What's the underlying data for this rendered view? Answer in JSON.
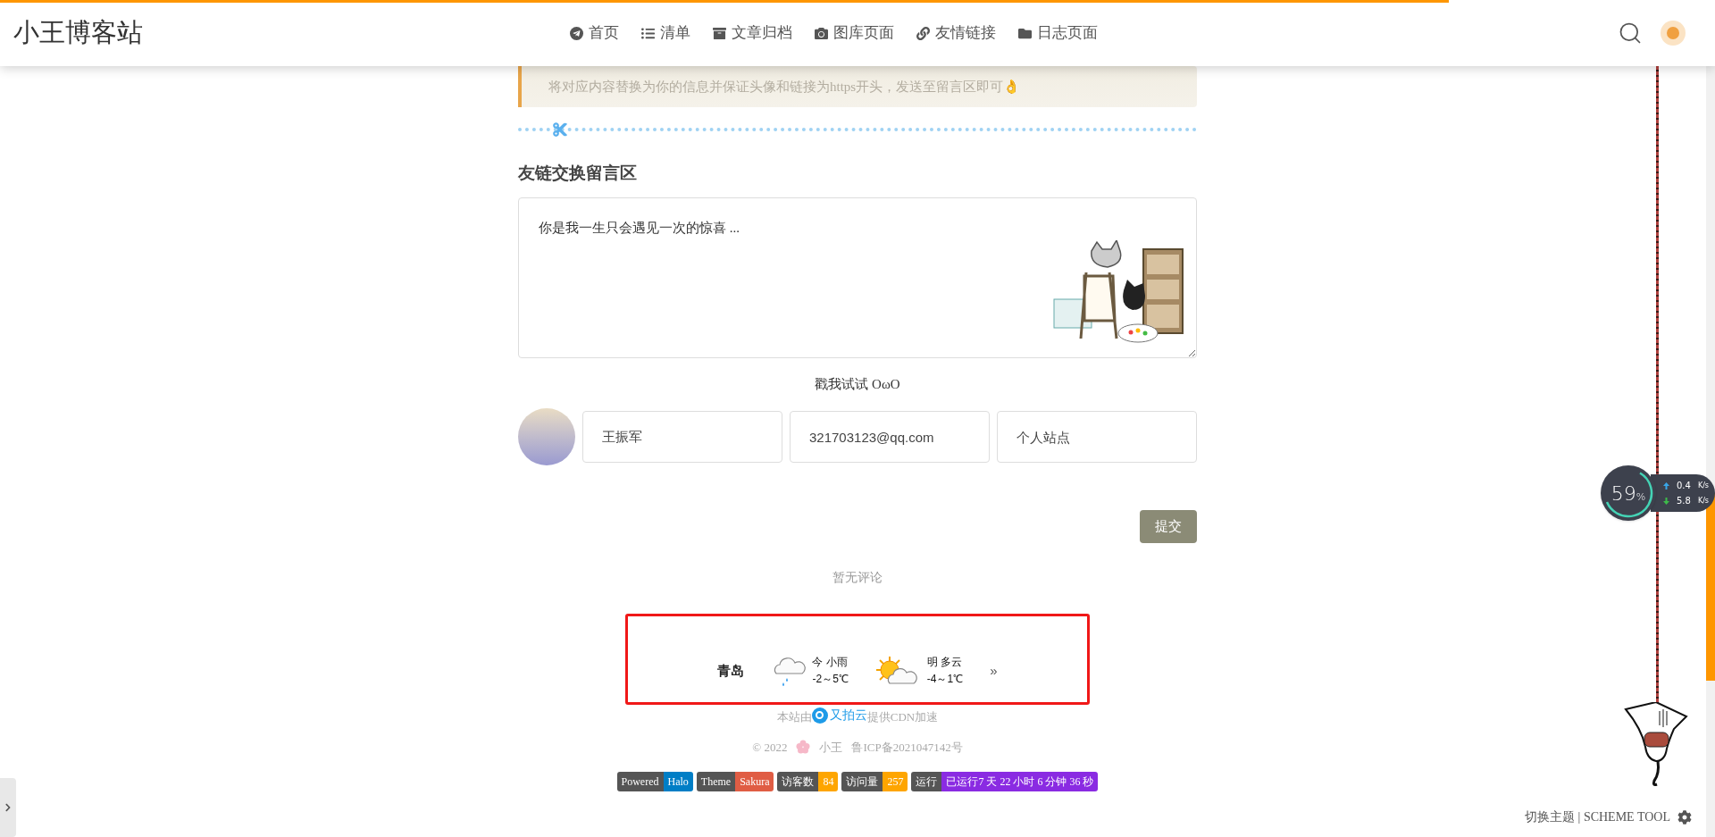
{
  "progress": {
    "level": 0.845
  },
  "header": {
    "site_title": "小王博客站",
    "nav": [
      {
        "label": "首页",
        "kind": "plane"
      },
      {
        "label": "清单",
        "kind": "list"
      },
      {
        "label": "文章归档",
        "kind": "archive"
      },
      {
        "label": "图库页面",
        "kind": "camera"
      },
      {
        "label": "友情链接",
        "kind": "link"
      },
      {
        "label": "日志页面",
        "kind": "folder"
      }
    ]
  },
  "notice": {
    "text": "将对应内容替换为你的信息并保证头像和链接为https开头，发送至留言区即可👌"
  },
  "comment_form": {
    "heading": "友链交换留言区",
    "textarea_placeholder": "你是我一生只会遇见一次的惊喜 ...",
    "emoji_toggle": "戳我试试 OωO",
    "fields": [
      {
        "kind": "value",
        "value": "王振军"
      },
      {
        "kind": "value",
        "value": "321703123@qq.com"
      },
      {
        "kind": "placeholder",
        "placeholder": "个人站点"
      }
    ],
    "submit": "提交"
  },
  "comments_empty": "暂无评论",
  "weather": {
    "city": "青岛",
    "days": [
      {
        "kind": "rain",
        "label": "今 小雨",
        "range": "-2～5℃"
      },
      {
        "kind": "sun_cloud",
        "label": "明 多云",
        "range": "-4～1℃"
      }
    ],
    "more": "»"
  },
  "footer": {
    "cdn_before": "本站由",
    "cdn_brand": "又拍云",
    "cdn_after": "提供CDN加速",
    "copyright": "© 2022",
    "author": "小王",
    "icp": "鲁ICP备2021047142号",
    "badges": [
      {
        "label": "Powered",
        "value": "Halo",
        "color": "#007ec6"
      },
      {
        "label": "Theme",
        "value": "Sakura",
        "color": "#e05d44"
      },
      {
        "label": "访客数",
        "value": "84",
        "color": "#fea500"
      },
      {
        "label": "访问量",
        "value": "257",
        "color": "#fea500"
      },
      {
        "label": "运行",
        "value": "已运行7 天 22 小时 6 分钟 36 秒",
        "color": "#8a2be2"
      }
    ]
  },
  "net_monitor": {
    "percent": "59",
    "unit": "%",
    "up": {
      "value": "0.4",
      "unit": "K/s"
    },
    "down": {
      "value": "5.8",
      "unit": "K/s"
    }
  },
  "scheme_tool": {
    "label": "切换主题 | SCHEME TOOL"
  }
}
